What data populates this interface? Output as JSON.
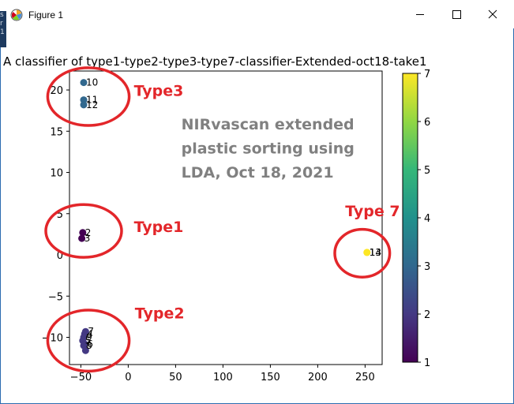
{
  "window": {
    "title": "Figure 1",
    "left_strip_chars": [
      "s",
      "r",
      "1"
    ]
  },
  "chart_data": {
    "type": "scatter",
    "title": "A classifier of type1-type2-type3-type7-classifier-Extended-oct18-take1",
    "xlabel": "",
    "ylabel": "",
    "xlim": [
      -62,
      268
    ],
    "ylim": [
      -13.3,
      22.3
    ],
    "xticks": [
      -50,
      0,
      50,
      100,
      150,
      200,
      250
    ],
    "xtick_labels": [
      "−50",
      "0",
      "50",
      "100",
      "150",
      "200",
      "250"
    ],
    "yticks": [
      -10,
      -5,
      0,
      5,
      10,
      15,
      20
    ],
    "ytick_labels": [
      "−10",
      "−5",
      "0",
      "5",
      "10",
      "15",
      "20"
    ],
    "grid": false,
    "colormap": "viridis",
    "points": [
      {
        "x": -47,
        "y": 20.9,
        "c": 3,
        "label": "10"
      },
      {
        "x": -47,
        "y": 18.8,
        "c": 3,
        "label": "11"
      },
      {
        "x": -47,
        "y": 18.2,
        "c": 3,
        "label": "12"
      },
      {
        "x": -48,
        "y": 2.7,
        "c": 1,
        "label": "2"
      },
      {
        "x": -49,
        "y": 2.0,
        "c": 1,
        "label": "3"
      },
      {
        "x": -45,
        "y": -9.3,
        "c": 2,
        "label": "7"
      },
      {
        "x": -46,
        "y": -9.6,
        "c": 2,
        "label": "4"
      },
      {
        "x": -47,
        "y": -10.0,
        "c": 2,
        "label": "9"
      },
      {
        "x": -48,
        "y": -10.4,
        "c": 2,
        "label": "5"
      },
      {
        "x": -46,
        "y": -10.8,
        "c": 2,
        "label": "6"
      },
      {
        "x": -47,
        "y": -11.0,
        "c": 2,
        "label": "8"
      },
      {
        "x": -45,
        "y": -11.6,
        "c": 2,
        "label": ""
      },
      {
        "x": 252,
        "y": 0.3,
        "c": 7,
        "label": "13"
      },
      {
        "x": 252,
        "y": 0.3,
        "c": 7,
        "label": "14"
      }
    ],
    "colorbar": {
      "ticks": [
        1,
        2,
        3,
        4,
        5,
        6,
        7
      ],
      "tick_labels": [
        "1",
        "2",
        "3",
        "4",
        "5",
        "6",
        "7"
      ]
    },
    "annotations": {
      "note_lines": [
        "NIRvascan extended",
        "plastic sorting using",
        "LDA, Oct 18, 2021"
      ],
      "note_color": "#808080",
      "ann_color": "#e3262a",
      "type_labels": [
        {
          "text": "Type3",
          "x": 6,
          "y": 19.3
        },
        {
          "text": "Type1",
          "x": 6,
          "y": 2.8
        },
        {
          "text": "Type2",
          "x": 7,
          "y": -7.7
        },
        {
          "text": "Type 7",
          "x": 229,
          "y": 4.7
        }
      ],
      "circles": [
        {
          "cx": -42,
          "cy": 19.2,
          "rx": 43,
          "ry": 3.5
        },
        {
          "cx": -47,
          "cy": 2.9,
          "rx": 40,
          "ry": 3.2
        },
        {
          "cx": -42,
          "cy": -10.4,
          "rx": 43,
          "ry": 3.7
        },
        {
          "cx": 247,
          "cy": 0.2,
          "rx": 29,
          "ry": 2.9
        }
      ]
    }
  }
}
